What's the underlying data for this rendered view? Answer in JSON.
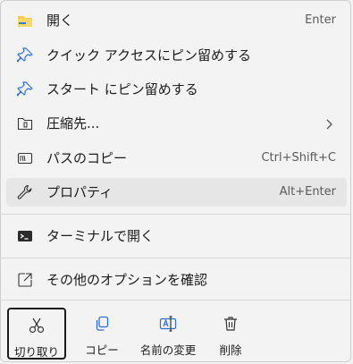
{
  "menu": {
    "items": [
      {
        "label": "開く",
        "shortcut": "Enter",
        "icon": "folder-icon"
      },
      {
        "label": "クイック アクセスにピン留めする",
        "shortcut": "",
        "icon": "pin-icon"
      },
      {
        "label": "スタート にピン留めする",
        "shortcut": "",
        "icon": "pin-icon"
      },
      {
        "label": "圧縮先...",
        "shortcut": "",
        "icon": "archive-icon",
        "has_submenu": true
      },
      {
        "label": "パスのコピー",
        "shortcut": "Ctrl+Shift+C",
        "icon": "copy-path-icon"
      },
      {
        "label": "プロパティ",
        "shortcut": "Alt+Enter",
        "icon": "wrench-icon"
      },
      {
        "label": "ターミナルで開く",
        "shortcut": "",
        "icon": "terminal-icon"
      },
      {
        "label": "その他のオプションを確認",
        "shortcut": "",
        "icon": "more-options-icon"
      }
    ],
    "bottom_actions": [
      {
        "label": "切り取り",
        "icon": "cut-icon",
        "focused": true
      },
      {
        "label": "コピー",
        "icon": "copy-icon"
      },
      {
        "label": "名前の変更",
        "icon": "rename-icon"
      },
      {
        "label": "削除",
        "icon": "delete-icon"
      }
    ],
    "hovered_item_index": 5
  }
}
